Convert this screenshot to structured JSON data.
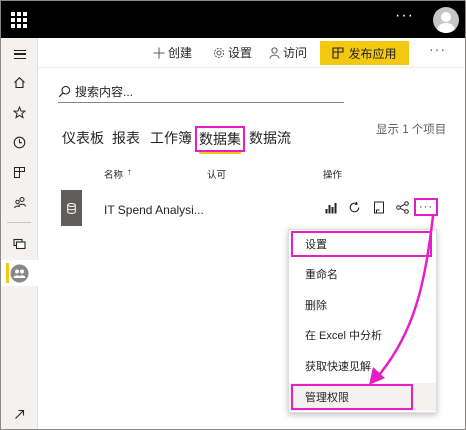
{
  "topbar": {
    "more": "···"
  },
  "actionbar": {
    "create": "创建",
    "settings": "设置",
    "access": "访问",
    "publish": "发布应用",
    "more": "···"
  },
  "search": {
    "placeholder": "搜索内容..."
  },
  "tabs": [
    {
      "label": "仪表板",
      "active": false
    },
    {
      "label": "报表",
      "active": false
    },
    {
      "label": "工作簿",
      "active": false
    },
    {
      "label": "数据集",
      "active": true
    },
    {
      "label": "数据流",
      "active": false
    }
  ],
  "item_count": "显示 1 个项目",
  "table": {
    "headers": {
      "name": "名称",
      "sort_arrow": "↑",
      "endorsement": "认可",
      "actions": "操作"
    },
    "rows": [
      {
        "name": "IT Spend Analysi..."
      }
    ]
  },
  "context_menu": {
    "items": [
      "设置",
      "重命名",
      "删除",
      "在 Excel 中分析",
      "获取快速见解",
      "管理权限"
    ]
  },
  "colors": {
    "accent": "#f2c811",
    "highlight": "#e61ec8",
    "topbar": "#000000"
  }
}
